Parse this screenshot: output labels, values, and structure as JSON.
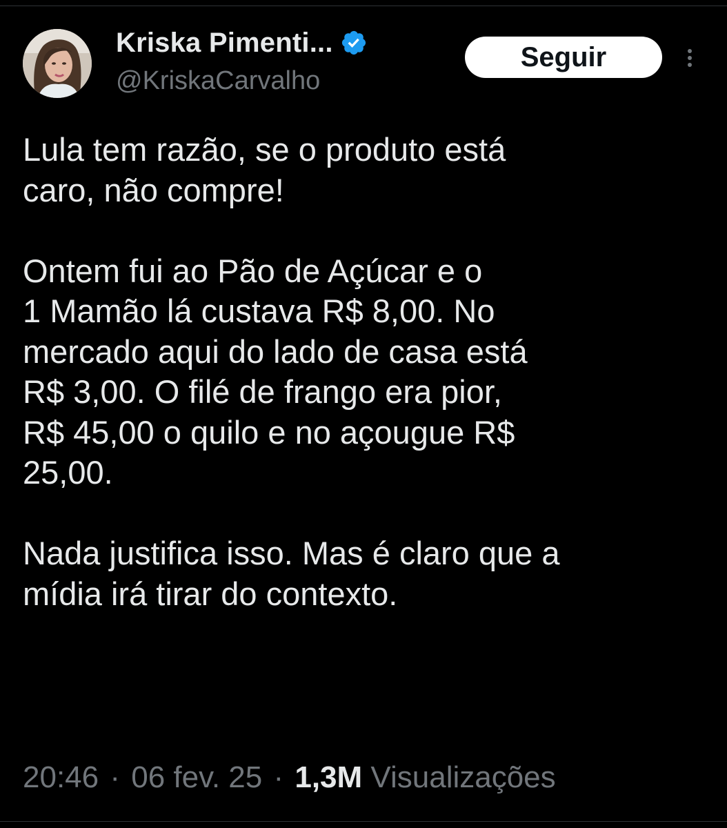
{
  "author": {
    "display_name": "Kriska Pimenti...",
    "handle": "@KriskaCarvalho",
    "verified_icon": "verified-badge-icon",
    "avatar_icon": "profile-photo"
  },
  "follow_button": {
    "label": "Seguir"
  },
  "more_menu": {
    "icon": "more-vertical-icon"
  },
  "tweet": {
    "paragraphs": [
      "Lula tem razão, se o produto está\ncaro, não compre!",
      "Ontem fui ao Pão de Açúcar e o\n1 Mamão lá custava R$ 8,00. No\nmercado aqui do lado de casa está\nR$ 3,00. O filé de frango era pior,\nR$ 45,00 o quilo e no açougue R$\n25,00.",
      "Nada justifica isso. Mas é claro que a\nmídia irá tirar do contexto."
    ],
    "time": "20:46",
    "separator": "·",
    "date": "06 fev. 25",
    "views_count": "1,3M",
    "views_label": "Visualizações"
  },
  "colors": {
    "background": "#000000",
    "text_primary": "#e7e9ea",
    "text_secondary": "#71767b",
    "verified_blue": "#1d9bf0",
    "button_bg": "#ffffff",
    "button_text": "#0f1419"
  }
}
